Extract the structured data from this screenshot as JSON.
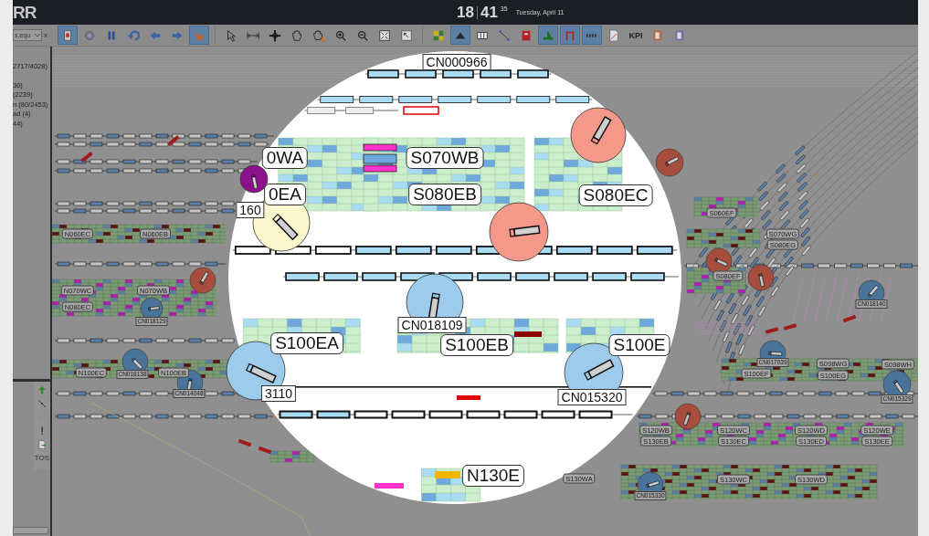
{
  "app": {
    "logo": "RR"
  },
  "clock": {
    "hours": "18",
    "minutes": "41",
    "seconds": "35",
    "date": "Tuesday, April 11"
  },
  "filter": {
    "value": "s,equ",
    "clear": "x"
  },
  "toolbar": {
    "groups": [
      [
        {
          "kind": "icon",
          "selected": true
        },
        {
          "kind": "icon",
          "selected": false
        },
        {
          "kind": "icon",
          "selected": false
        },
        {
          "kind": "icon",
          "selected": false
        },
        {
          "kind": "icon",
          "selected": false
        },
        {
          "kind": "icon",
          "selected": false
        },
        {
          "kind": "icon",
          "selected": true
        }
      ],
      [
        {
          "kind": "icon",
          "selected": false
        },
        {
          "kind": "icon",
          "selected": false
        },
        {
          "kind": "icon",
          "selected": false
        },
        {
          "kind": "icon",
          "selected": false
        },
        {
          "kind": "icon",
          "selected": false
        },
        {
          "kind": "icon",
          "selected": false
        },
        {
          "kind": "icon",
          "selected": false
        },
        {
          "kind": "icon",
          "selected": false
        },
        {
          "kind": "icon",
          "selected": false
        }
      ],
      [
        {
          "kind": "icon",
          "selected": false
        },
        {
          "kind": "icon",
          "selected": true
        },
        {
          "kind": "icon",
          "selected": false
        },
        {
          "kind": "icon",
          "selected": false
        },
        {
          "kind": "icon",
          "selected": false
        },
        {
          "kind": "icon",
          "selected": true
        },
        {
          "kind": "icon",
          "selected": true
        },
        {
          "kind": "icon",
          "selected": true
        },
        {
          "kind": "icon",
          "selected": false
        },
        {
          "kind": "text",
          "label": "KPI",
          "selected": false
        },
        {
          "kind": "icon",
          "selected": false
        },
        {
          "kind": "icon",
          "selected": false
        }
      ]
    ]
  },
  "legend": {
    "lines": [
      "2717/4028)",
      "30)",
      "(2239)",
      "n (80/2453)",
      "ad (4)",
      "44)"
    ]
  },
  "tools": [
    {
      "kind": "icon"
    },
    {
      "kind": "icon"
    },
    {
      "kind": "icon"
    },
    {
      "kind": "icon"
    },
    {
      "kind": "icon"
    },
    {
      "kind": "text",
      "label": "TOS"
    }
  ],
  "map": {
    "labels": [
      {
        "text": "N060EC"
      },
      {
        "text": "N060EB"
      },
      {
        "text": "N070WC"
      },
      {
        "text": "N070WB"
      },
      {
        "text": "N080EC"
      },
      {
        "text": "N100EC"
      },
      {
        "text": "N100EB"
      },
      {
        "text": "S060EF"
      },
      {
        "text": "S070WG"
      },
      {
        "text": "S080EG"
      },
      {
        "text": "S080EF"
      },
      {
        "text": "S098WG"
      },
      {
        "text": "S100EG"
      },
      {
        "text": "S100EF"
      },
      {
        "text": "S098WH"
      },
      {
        "text": "S120WB"
      },
      {
        "text": "S130EB"
      },
      {
        "text": "S120WC"
      },
      {
        "text": "S130EC"
      },
      {
        "text": "S120WD"
      },
      {
        "text": "S130ED"
      },
      {
        "text": "S120WE"
      },
      {
        "text": "S130EE"
      },
      {
        "text": "S130WA"
      },
      {
        "text": "S130WC"
      },
      {
        "text": "S130WD"
      }
    ],
    "equipment": [
      {
        "color": "#a64d3e"
      },
      {
        "label": "CN018129",
        "color": "#4a7399"
      },
      {
        "label": "CN018138",
        "color": "#4a7399"
      },
      {
        "label": "CN014048",
        "color": "#4a7399"
      },
      {
        "color": "#a64d3e"
      },
      {
        "color": "#a64d3e"
      },
      {
        "color": "#a64d3e"
      },
      {
        "label": "CN018140",
        "color": "#4a7399"
      },
      {
        "label": "CN017039",
        "color": "#4a7399"
      },
      {
        "label": "CN015329",
        "color": "#4a7399"
      },
      {
        "color": "#a64d3e"
      },
      {
        "label": "CN015330",
        "color": "#4a7399"
      }
    ]
  },
  "magnifier": {
    "labels": [
      {
        "text": "CN000966",
        "kind": "id"
      },
      {
        "text": "0WA",
        "kind": "track"
      },
      {
        "text": "S070WB",
        "kind": "track"
      },
      {
        "text": "0EA",
        "kind": "track"
      },
      {
        "text": "S080EB",
        "kind": "track"
      },
      {
        "text": "S080EC",
        "kind": "track"
      },
      {
        "text": "S100EA",
        "kind": "track"
      },
      {
        "text": "S100EB",
        "kind": "track"
      },
      {
        "text": "S100E",
        "kind": "track"
      },
      {
        "text": "N130E",
        "kind": "track"
      }
    ],
    "equipment": [
      {
        "color": "#f4998a"
      },
      {
        "color": "#f4998a"
      },
      {
        "label": "160",
        "color": "#fbf8cf"
      },
      {
        "label": "CN018109",
        "color": "#9dcbeb"
      },
      {
        "label": "CN015320",
        "color": "#9dcbeb"
      },
      {
        "label": "3110",
        "color": "#9dcbeb"
      },
      {
        "color": "#8b128b"
      }
    ]
  }
}
